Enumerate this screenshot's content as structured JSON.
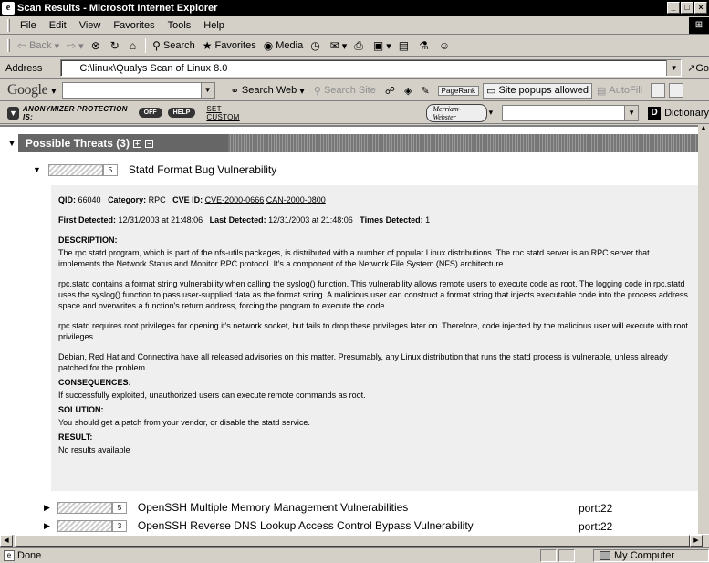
{
  "window": {
    "title": "Scan Results - Microsoft Internet Explorer",
    "icon": "ie-icon",
    "controls": [
      "minimize",
      "maximize",
      "close"
    ]
  },
  "menu": [
    "File",
    "Edit",
    "View",
    "Favorites",
    "Tools",
    "Help"
  ],
  "toolbar": {
    "back": "Back",
    "search": "Search",
    "favorites": "Favorites",
    "media": "Media"
  },
  "address": {
    "label": "Address",
    "value": "C:\\linux\\Qualys Scan of Linux 8.0",
    "go": "Go"
  },
  "google": {
    "logo": "Google",
    "search_web": "Search Web",
    "search_site": "Search Site",
    "pagerank": "PageRank",
    "popups": "Site popups allowed",
    "autofill": "AutoFill"
  },
  "anonymizer": {
    "label": "ANONYMIZER PROTECTION IS:",
    "off": "OFF",
    "help": "HELP",
    "set_custom": "SET CUSTOM",
    "mw_logo": "Merriam-Webster",
    "dictionary": "Dictionary"
  },
  "content": {
    "section_title": "Possible Threats (3)",
    "threats": [
      {
        "severity": "5",
        "name": "Statd Format Bug Vulnerability",
        "port": ""
      },
      {
        "severity": "5",
        "name": "OpenSSH Multiple Memory Management Vulnerabilities",
        "port": "port:22"
      },
      {
        "severity": "3",
        "name": "OpenSSH Reverse DNS Lookup Access Control Bypass Vulnerability",
        "port": "port:22"
      }
    ],
    "detail": {
      "qid_label": "QID:",
      "qid": "66040",
      "category_label": "Category:",
      "category": "RPC",
      "cve_label": "CVE ID:",
      "cve1": "CVE-2000-0666",
      "cve2": "CAN-2000-0800",
      "first_label": "First Detected:",
      "first": "12/31/2003 at 21:48:06",
      "last_label": "Last Detected:",
      "last": "12/31/2003 at 21:48:06",
      "times_label": "Times Detected:",
      "times": "1",
      "description_label": "DESCRIPTION:",
      "desc1": "The rpc.statd program, which is part of the nfs-utils packages, is distributed with a number of popular Linux distributions. The rpc.statd server is an RPC server that implements the Network Status and Monitor RPC protocol. It's a component of the Network File System (NFS) architecture.",
      "desc2": "rpc.statd contains a format string vulnerability when calling the syslog() function. This vulnerability allows remote users to execute code as root. The logging code in rpc.statd uses the syslog() function to pass user-supplied data as the format string. A malicious user can construct a format string that injects executable code into the process address space and overwrites a function's return address, forcing the program to execute the code.",
      "desc3": "rpc.statd requires root privileges for opening it's network socket, but fails to drop these privileges later on. Therefore, code injected by the malicious user will execute with root privileges.",
      "desc4": "Debian, Red Hat and Connectiva have all released advisories on this matter. Presumably, any Linux distribution that runs the statd process is vulnerable, unless already patched for the problem.",
      "consequences_label": "CONSEQUENCES:",
      "consequences": "If successfully exploited, unauthorized users can execute remote commands as root.",
      "solution_label": "SOLUTION:",
      "solution": "You should get a patch from your vendor, or disable the statd service.",
      "result_label": "RESULT:",
      "result": "No results available"
    }
  },
  "status": {
    "text": "Done",
    "zone": "My Computer"
  }
}
